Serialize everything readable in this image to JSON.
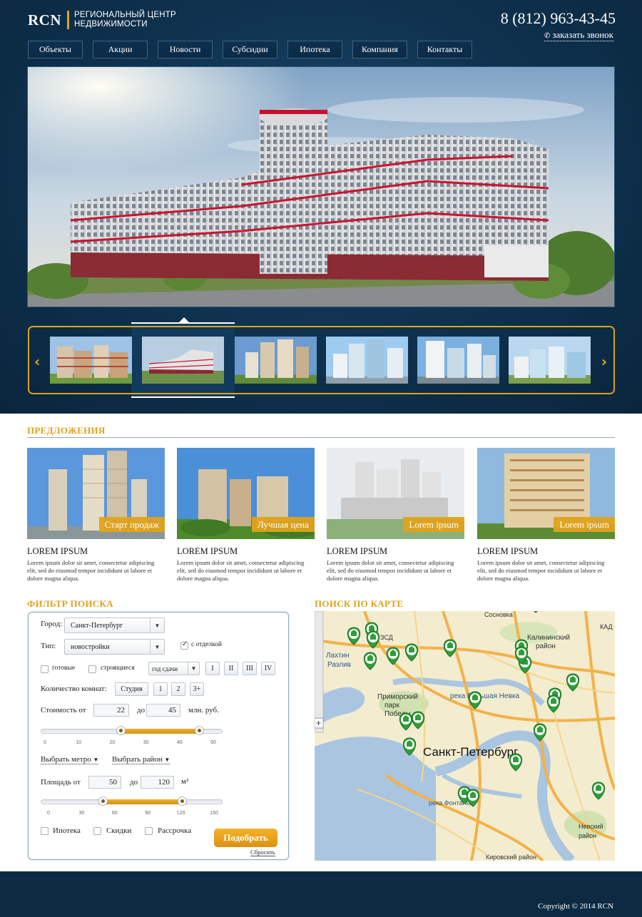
{
  "header": {
    "logo_mark": "RCN",
    "logo_line1": "РЕГИОНАЛЬНЫЙ ЦЕНТР",
    "logo_line2": "НЕДВИЖИМОСТИ",
    "phone": "8 (812) 963-43-45",
    "callback": "заказать звонок"
  },
  "nav": [
    "Объекты",
    "Акции",
    "Новости",
    "Субсидии",
    "Ипотека",
    "Компания",
    "Контакты"
  ],
  "offers": {
    "title": "ПРЕДЛОЖЕНИЯ",
    "items": [
      {
        "tag": "Старт продаж",
        "title": "LOREM IPSUM",
        "text": "Lorem ipsum dolor sit amet, consectetur adipiscing elit, sed do eiusmod tempor incididunt ut labore et dolore magna aliqua."
      },
      {
        "tag": "Лучшая цена",
        "title": "LOREM IPSUM",
        "text": "Lorem ipsum dolor sit amet, consectetur adipiscing elit, sed do eiusmod tempor incididunt ut labore et dolore magna aliqua."
      },
      {
        "tag": "Lorem ipsum",
        "title": "LOREM IPSUM",
        "text": "Lorem ipsum dolor sit amet, consectetur adipiscing elit, sed do eiusmod tempor incididunt ut labore et dolore magna aliqua."
      },
      {
        "tag": "Lorem ipsum",
        "title": "LOREM IPSUM",
        "text": "Lorem ipsum dolor sit amet, consectetur adipiscing elit, sed do eiusmod tempor incididunt ut labore et dolore magna aliqua."
      }
    ]
  },
  "filter": {
    "title": "ФИЛЬТР ПОИСКА",
    "city_label": "Город:",
    "city_value": "Санкт-Петербург",
    "type_label": "Тип:",
    "type_value": "новостройки",
    "finish_label": "с отделкой",
    "finish_checked": true,
    "ready_label": "готовые",
    "building_label": "строящиеся",
    "year_value": "год сдачи",
    "quarters": [
      "I",
      "II",
      "III",
      "IV"
    ],
    "rooms_label": "Количество комнат:",
    "rooms": [
      "Студия",
      "1",
      "2",
      "3+"
    ],
    "price_label": "Стоимость от",
    "price_from": "22",
    "to_label": "до",
    "price_to": "45",
    "price_unit": "млн. руб.",
    "price_ticks": [
      "0",
      "10",
      "20",
      "30",
      "40",
      "50"
    ],
    "price_range": [
      22,
      45
    ],
    "price_max": 50,
    "metro_link": "Выбрать метро",
    "district_link": "Выбрать район",
    "area_label": "Площадь от",
    "area_from": "50",
    "area_to": "120",
    "area_unit": "м²",
    "area_ticks": [
      "0",
      "30",
      "60",
      "90",
      "120",
      "150"
    ],
    "area_range": [
      50,
      120
    ],
    "area_max": 150,
    "mortgage_label": "Ипотека",
    "discount_label": "Скидки",
    "installment_label": "Рассрочка",
    "submit": "Подобрать",
    "reset": "Сбросить"
  },
  "map": {
    "title": "ПОИСК ПО КАРТЕ",
    "labels": {
      "city": "Санкт-Петербург",
      "district1": "Калининский",
      "district1b": "район",
      "park": "Приморский",
      "park2": "парк",
      "park3": "Победы",
      "river": "река Большая Невка",
      "lakhta": "Лахтин",
      "lakhta2": "Разлив",
      "sosnovka": "Сосновка",
      "nevsky": "Невский",
      "nevsky2": "район",
      "kirov": "Кировский район",
      "fontanka": "река Фонтанка",
      "zsd": "ЗСД",
      "kad": "КАД"
    }
  },
  "footer": {
    "copyright": "Copyright © 2014 RCN"
  },
  "colors": {
    "accent": "#e0a21b",
    "dark": "#0c2a42",
    "marker": "#2f9f3a"
  }
}
